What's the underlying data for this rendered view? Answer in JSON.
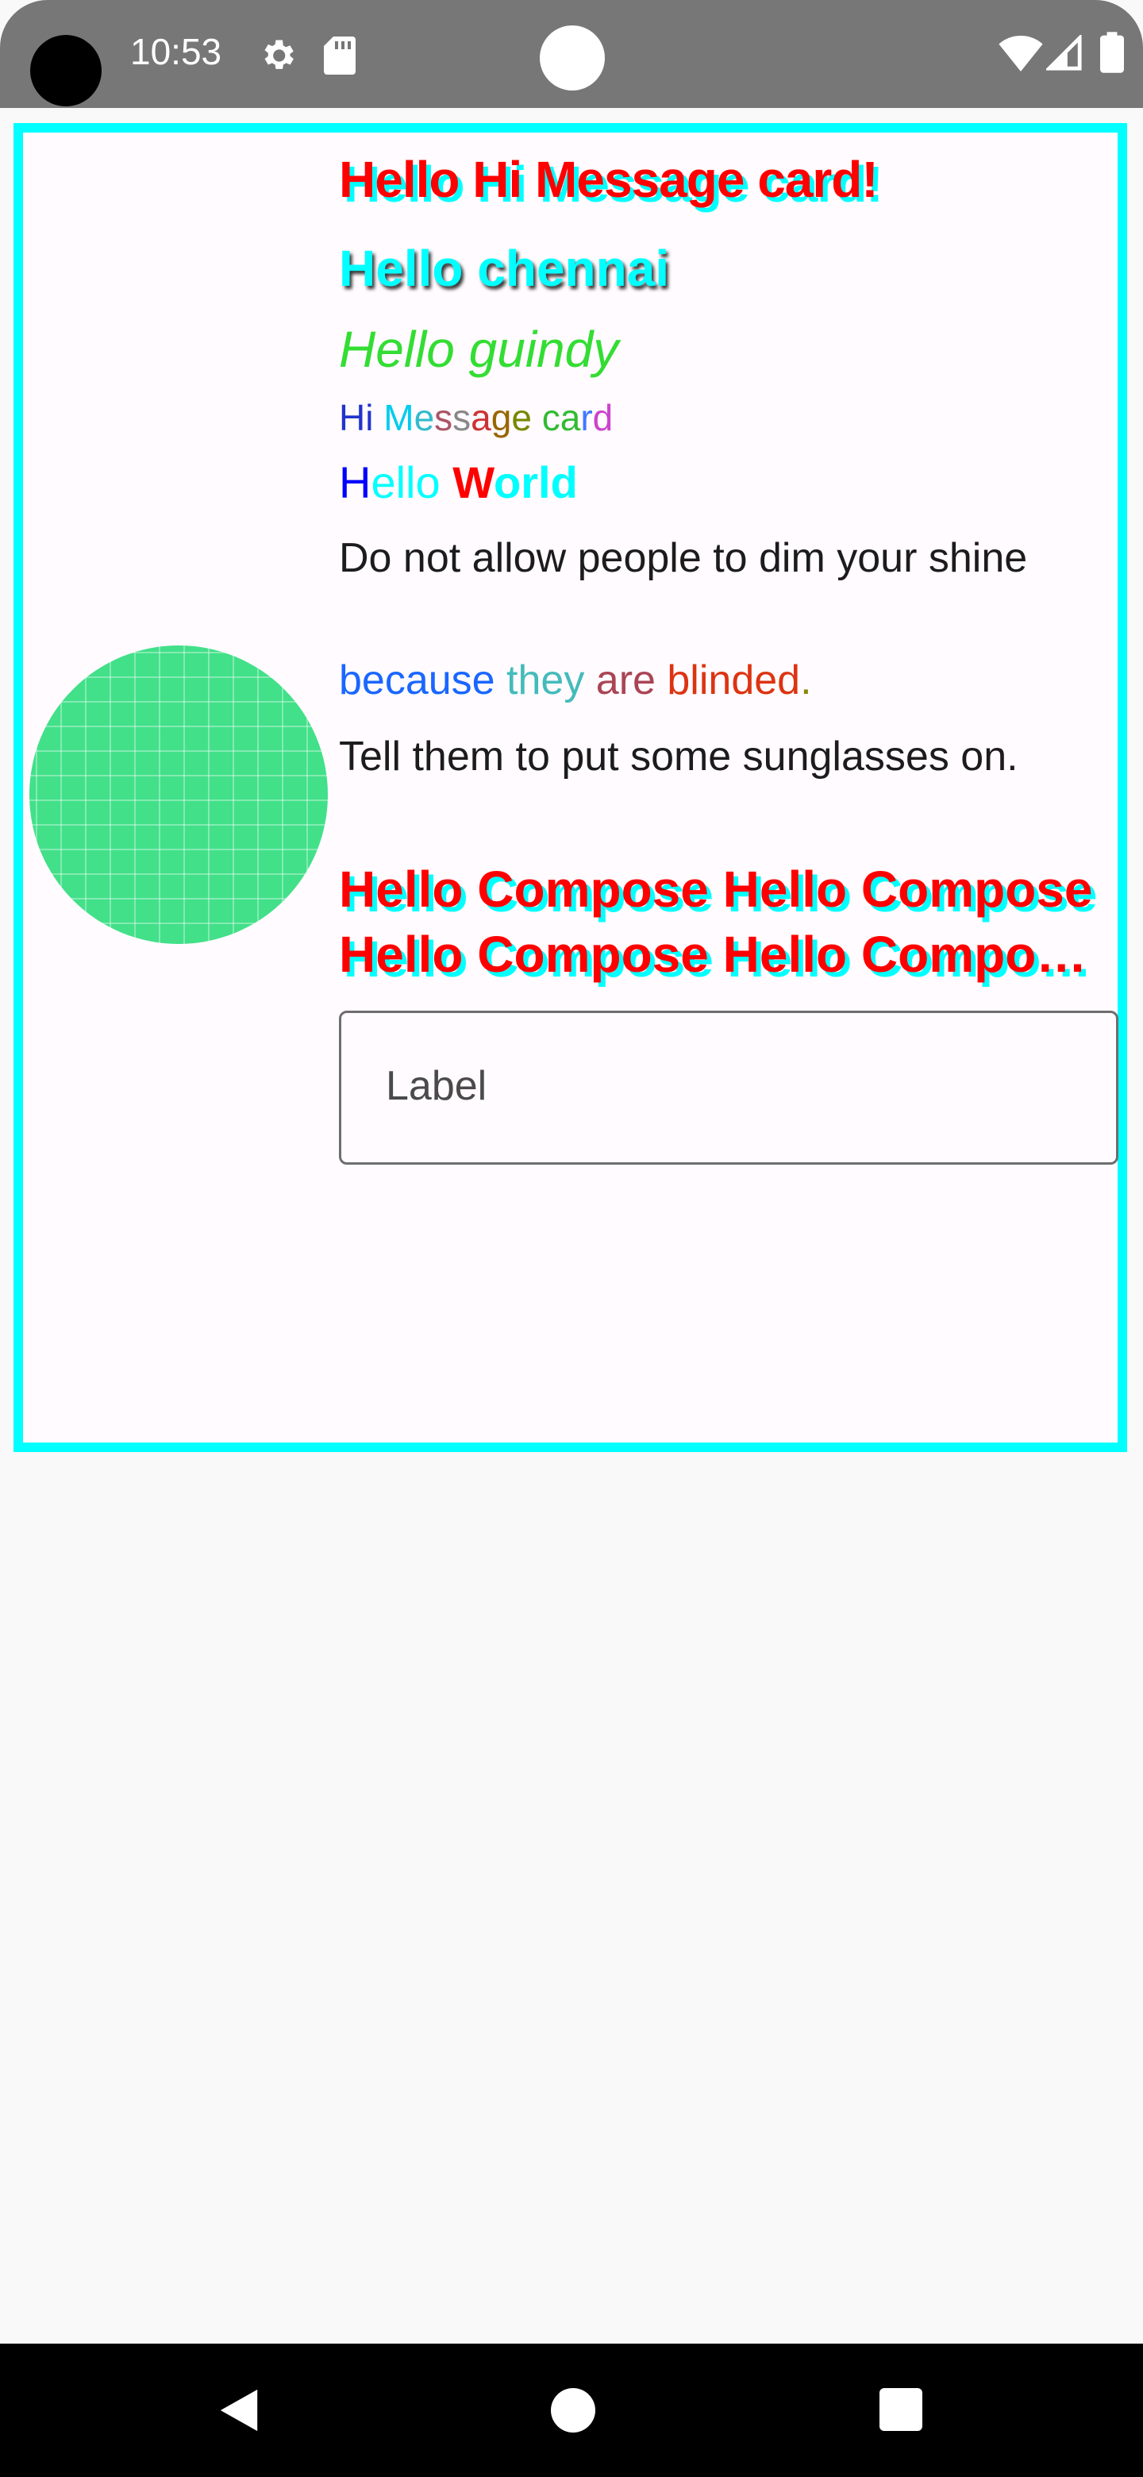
{
  "status_bar": {
    "time": "10:53",
    "icons": [
      "settings-gear-icon",
      "sd-card-icon",
      "wifi-icon",
      "signal-icon",
      "battery-icon"
    ],
    "background": "#777777"
  },
  "card": {
    "border_color": "#00ffff",
    "title": "Hello Hi Message card!",
    "subtitle": "Hello chennai",
    "italic_line": "Hello guindy",
    "message": {
      "segments": [
        {
          "text": "Hi",
          "color": "#2233cc"
        },
        {
          "text": " ",
          "color": "#000000"
        },
        {
          "text": "M",
          "color": "#00ccee"
        },
        {
          "text": "e",
          "color": "#33bbcc"
        },
        {
          "text": "s",
          "color": "#aa5566"
        },
        {
          "text": "s",
          "color": "#888888"
        },
        {
          "text": "a",
          "color": "#cc3333"
        },
        {
          "text": "g",
          "color": "#996600"
        },
        {
          "text": "e",
          "color": "#778800"
        },
        {
          "text": " ",
          "color": "#000000"
        },
        {
          "text": "c",
          "color": "#33bb33"
        },
        {
          "text": "a",
          "color": "#33bb33"
        },
        {
          "text": "r",
          "color": "#4477ff"
        },
        {
          "text": "d",
          "color": "#cc44cc"
        }
      ]
    },
    "hello_world": {
      "h": "H",
      "ello": "ello ",
      "w": "W",
      "orld": "orld"
    },
    "quote_line1": "Do not allow people to dim your shine",
    "quote_line2": {
      "segments": [
        {
          "text": "because ",
          "color": "#1a66ff"
        },
        {
          "text": "they ",
          "color": "#44bbbb"
        },
        {
          "text": "are ",
          "color": "#aa4455"
        },
        {
          "text": "blinded",
          "color": "#dd3311"
        },
        {
          "text": ".",
          "color": "#888800"
        }
      ]
    },
    "quote_line3": "Tell them to put some sunglasses on.",
    "compose_text": "Hello Compose Hello Compose Hello Compose Hello Compo…",
    "text_field": {
      "label": "Label"
    },
    "circle_color": "#42e089"
  },
  "nav_bar": {
    "buttons": [
      "back-icon",
      "home-icon",
      "recents-icon"
    ]
  }
}
